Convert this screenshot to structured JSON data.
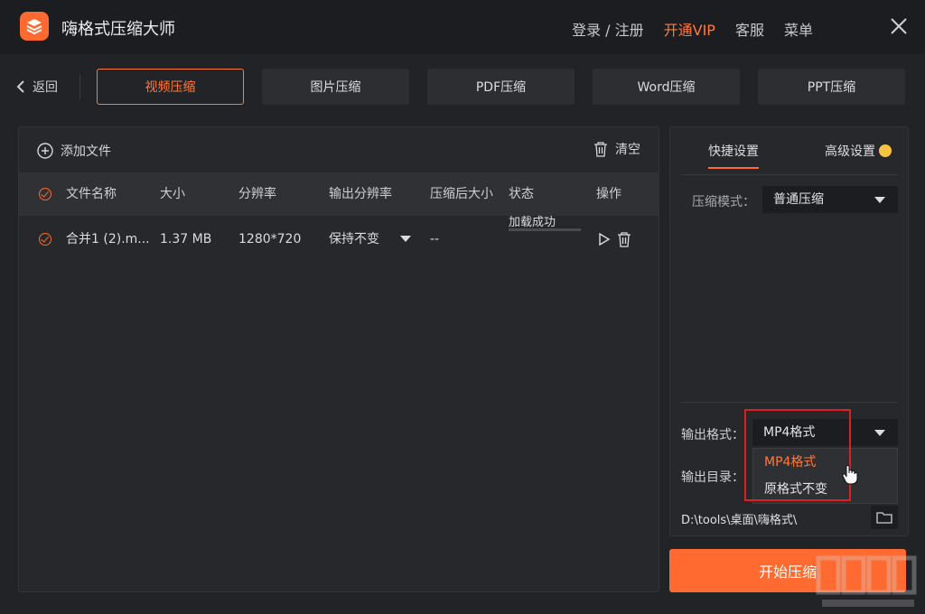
{
  "app": {
    "title": "嗨格式压缩大师",
    "logo_icon": "layers-icon"
  },
  "header": {
    "links": [
      {
        "label": "登录 / 注册",
        "style": "login"
      },
      {
        "label": "开通VIP",
        "style": "vip"
      },
      {
        "label": "客服",
        "style": "normal"
      },
      {
        "label": "菜单",
        "style": "normal"
      }
    ],
    "close_icon": "close-icon"
  },
  "nav": {
    "back_label": "返回",
    "tabs": [
      {
        "label": "视频压缩",
        "active": true
      },
      {
        "label": "图片压缩",
        "active": false
      },
      {
        "label": "PDF压缩",
        "active": false
      },
      {
        "label": "Word压缩",
        "active": false
      },
      {
        "label": "PPT压缩",
        "active": false
      }
    ]
  },
  "file_panel": {
    "add_file_label": "添加文件",
    "clear_label": "清空",
    "columns": [
      "文件名称",
      "大小",
      "分辨率",
      "输出分辨率",
      "压缩后大小",
      "状态",
      "操作"
    ],
    "rows": [
      {
        "name": "合并1 (2).m...",
        "size": "1.37 MB",
        "resolution": "1280*720",
        "output_resolution": "保持不变",
        "compressed_size": "--",
        "status": "加载成功"
      }
    ]
  },
  "settings": {
    "tab_quick": "快捷设置",
    "tab_advanced": "高级设置",
    "compress_mode_label": "压缩模式：",
    "compress_mode_value": "普通压缩",
    "output_format_label": "输出格式：",
    "output_format_value": "MP4格式",
    "output_format_options": [
      "MP4格式",
      "原格式不变"
    ],
    "output_dir_label": "输出目录：",
    "output_dir_value": "D:\\tools\\桌面\\嗨格式\\"
  },
  "start_button_label": "开始压缩",
  "colors": {
    "accent": "#ff6a30",
    "background": "#222326",
    "panel": "#27282b",
    "highlight": "#e02020"
  }
}
